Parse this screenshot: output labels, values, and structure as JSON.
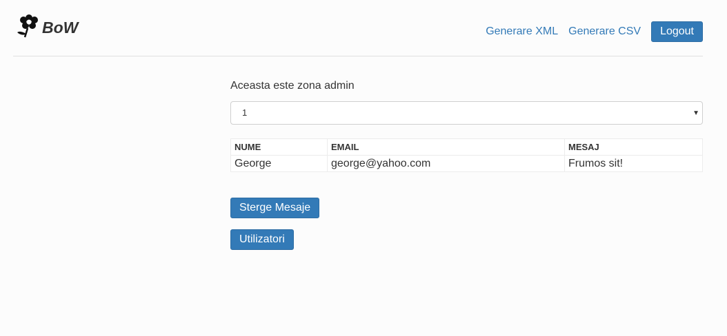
{
  "header": {
    "brand": "BoW",
    "nav": {
      "xml_label": "Generare XML",
      "csv_label": "Generare CSV",
      "logout_label": "Logout"
    }
  },
  "main": {
    "zone_text": "Aceasta este zona admin",
    "select_value": "1",
    "table": {
      "headers": [
        "NUME",
        "EMAIL",
        "MESAJ"
      ],
      "rows": [
        [
          "George",
          "george@yahoo.com",
          "Frumos sit!"
        ]
      ]
    },
    "buttons": {
      "delete_messages": "Sterge Mesaje",
      "users": "Utilizatori"
    }
  },
  "colors": {
    "primary": "#337ab7",
    "text": "#333333",
    "background": "#fcfcfc"
  }
}
